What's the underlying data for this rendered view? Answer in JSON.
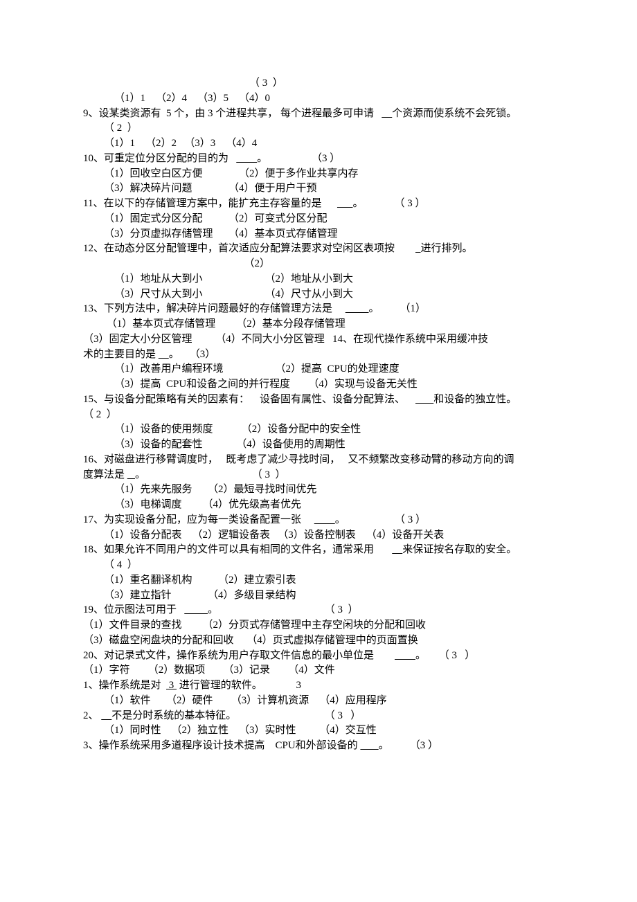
{
  "lines": [
    {
      "cls": "line",
      "text": "                                                                （ 3  ）"
    },
    {
      "cls": "line pad2",
      "text": "（1）1    （2）4    （3）5    （4）0"
    },
    {
      "cls": "line",
      "html": "9、设某类资源有  5 个，由 3 个进程共享， 每个进程最多可申请   <span class=\"u\">    </span>个资源而使系统不会死锁。"
    },
    {
      "cls": "line pad1",
      "text": "（ 2  ）"
    },
    {
      "cls": "line pad1",
      "text": "（1）1    （2）2   （3）3    （4）4"
    },
    {
      "cls": "line",
      "html": "10、可重定位分区分配的目的为   <span class=\"u\">        </span>。                 （3 ）"
    },
    {
      "cls": "line pad1",
      "text": "（1）回收空白区方便              （2）便于多作业共享内存"
    },
    {
      "cls": "line pad1",
      "text": "（3）解决碎片问题              （4）便于用户干预"
    },
    {
      "cls": "line",
      "html": "11、在以下的存储管理方案中，能扩充主存容量的是      <span class=\"u\">      </span>。            （ 3 ）"
    },
    {
      "cls": "line pad1",
      "text": "（1）固定式分区分配          （2）可变式分区分配"
    },
    {
      "cls": "line pad1",
      "text": "（3）分页虚拟存储管理      （4）基本页式存储管理"
    },
    {
      "cls": "line",
      "html": "12、在动态分区分配管理中，首次适应分配算法要求对空闲区表项按        <span class=\"u\">  </span>进行排列。"
    },
    {
      "cls": "line",
      "text": "                                                              （2）"
    },
    {
      "cls": "line pad2",
      "text": "（1）地址从大到小                        （2）地址从小到大"
    },
    {
      "cls": "line pad2",
      "text": "（3）尺寸从大到小                        （4）尺寸从小到大"
    },
    {
      "cls": "line",
      "html": "13、下列方法中，解决碎片问题最好的存储管理方法是     <span class=\"u\">         </span>。        （1）"
    },
    {
      "cls": "line pad1",
      "text": " （1）基本页式存储管理        （2）基本分段存储管理"
    },
    {
      "cls": "line",
      "text": "（3）固定大小分区管理         （4）不同大小分区管理   14、在现代操作系统中采用缓冲技"
    },
    {
      "cls": "line",
      "html": "术的主要目的是 <span class=\"u\">    </span>。    （3）"
    },
    {
      "cls": "line pad2",
      "text": "（1）改善用户编程环境                    （2）提高  CPU的处理速度"
    },
    {
      "cls": "line pad2",
      "text": "（3）提高  CPU和设备之间的并行程度       （4）实现与设备无关性"
    },
    {
      "cls": "line",
      "html": "15、与设备分配策略有关的因素有：    设备固有属性、设备分配算法、    <span class=\"u\">       </span>和设备的独立性。"
    },
    {
      "cls": "line",
      "text": "（ 2  ）"
    },
    {
      "cls": "line pad2",
      "text": "（1）设备的使用频度           （2）设备分配中的安全性"
    },
    {
      "cls": "line pad2",
      "text": "（3）设备的配套性             （4）设备使用的周期性"
    },
    {
      "cls": "line",
      "text": "16、对磁盘进行移臂调度时，   既考虑了减少寻找时间，   又不频繁改变移动臂的移动方向的调"
    },
    {
      "cls": "line",
      "html": "度算法是 <span class=\"u\">   </span>。                                         （ 3  ）"
    },
    {
      "cls": "line pad2",
      "text": "（1）先来先服务      （2）最短寻找时间优先"
    },
    {
      "cls": "line pad2",
      "text": "（3）电梯调度        （4）优先级高者优先"
    },
    {
      "cls": "line",
      "html": "17、为实现设备分配，应为每一类设备配置一张     <span class=\"u\">        </span>。                   （ 3 ）"
    },
    {
      "cls": "line pad1",
      "text": "（1）设备分配表    （2）逻辑设备表   （3）设备控制表    （4）设备开关表"
    },
    {
      "cls": "line",
      "html": "18、如果允许不同用户的文件可以具有相同的文件名，通常采用       <span class=\"u\">    </span>来保证按名存取的安全。"
    },
    {
      "cls": "line pad1",
      "text": "（ 4  ）"
    },
    {
      "cls": "line pad1",
      "text": "（1）重名翻译机构          （2）建立索引表"
    },
    {
      "cls": "line pad1",
      "text": "（3）建立指针              （4）多级目录结构"
    },
    {
      "cls": "line",
      "html": "19、位示图法可用于   <span class=\"u\">         </span>。                                         （ 3  ）"
    },
    {
      "cls": "line",
      "text": "（1）文件目录的查找        （2）分页式存储管理中主存空闲块的分配和回收"
    },
    {
      "cls": "line",
      "text": "（3）磁盘空闲盘块的分配和回收     （4）页式虚拟存储管理中的页面置换"
    },
    {
      "cls": "line",
      "html": "20、对记录式文件，操作系统为用户存取文件信息的最小单位是        <span class=\"u\">        </span>。     （ 3   ）"
    },
    {
      "cls": "line",
      "text": "（1）字符       （2）数据项       （3）记录       （4）文件"
    },
    {
      "cls": "line",
      "html": "1、操作系统是对  <span class=\"u\"> 3 </span> 进行管理的软件。             3"
    },
    {
      "cls": "line pad1",
      "text": "（1）软件      （2）硬件       （3）计算机资源    （4）应用程序"
    },
    {
      "cls": "line",
      "html": "2、 <span class=\"u\">    </span>不是分时系统的基本特征。                                  （ 3   ）"
    },
    {
      "cls": "line pad1",
      "text": "（1）同时性    （2）独立性    （3）实时性         （4）交互性"
    },
    {
      "cls": "line",
      "html": "3、操作系统采用多道程序设计技术提高    CPU和外部设备的 <span class=\"u\">       </span>。        （3 ）"
    }
  ]
}
